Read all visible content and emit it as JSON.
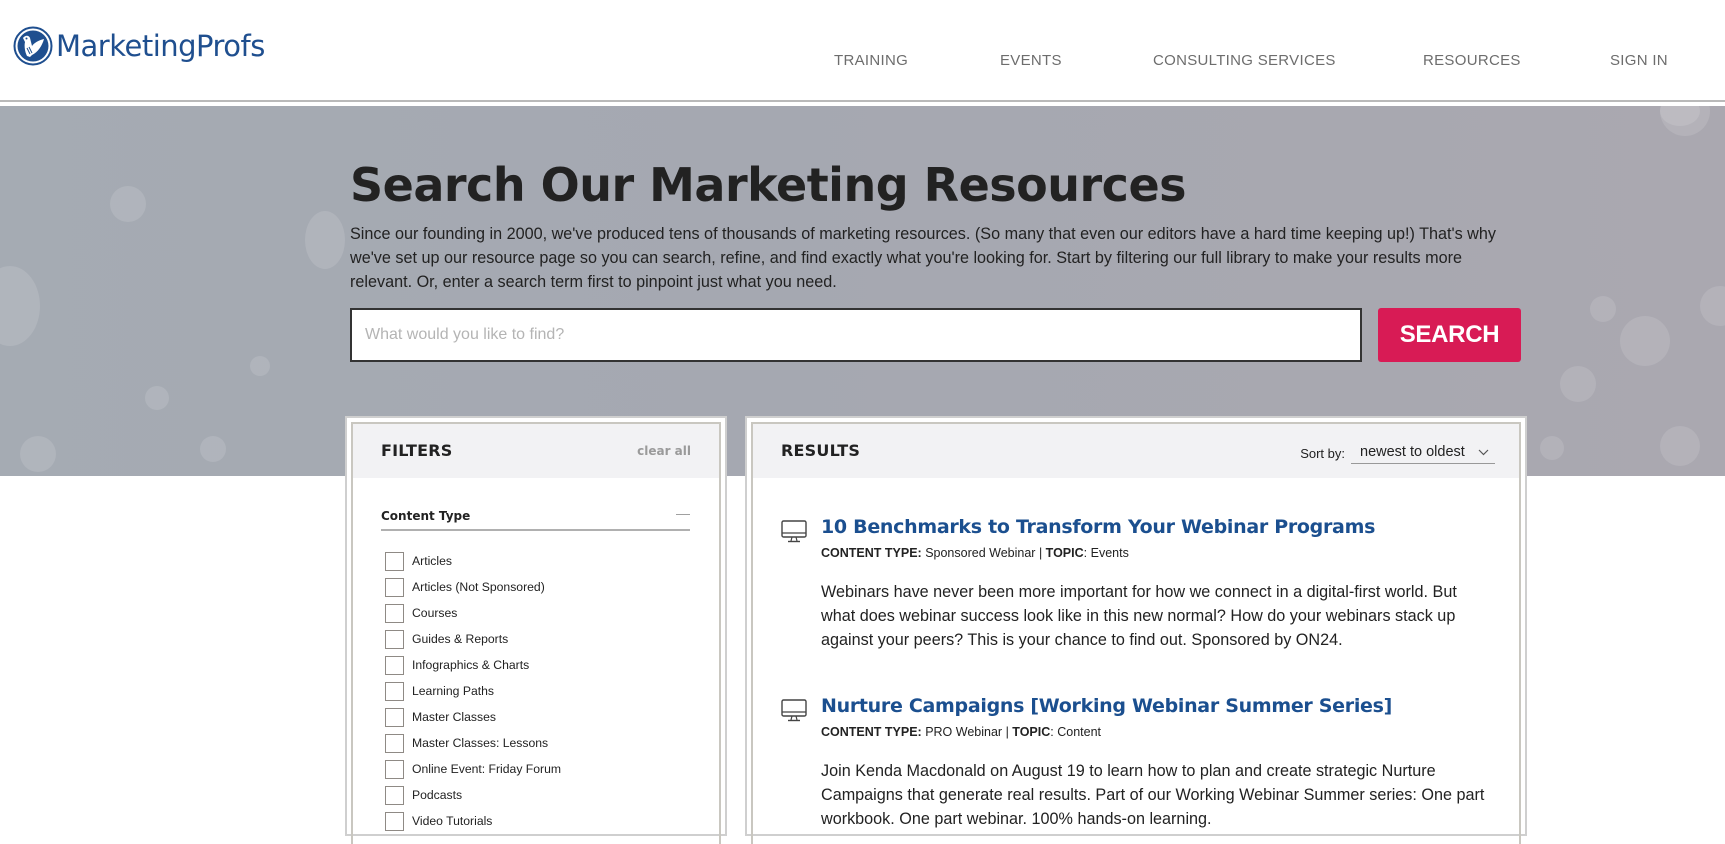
{
  "brand": {
    "name": "MarketingProfs",
    "logo_icon": "bird-circle-logo-icon",
    "brand_color": "#1f4f8f"
  },
  "nav": {
    "items": [
      {
        "label": "TRAINING"
      },
      {
        "label": "EVENTS"
      },
      {
        "label": "CONSULTING SERVICES"
      },
      {
        "label": "RESOURCES"
      },
      {
        "label": "SIGN IN"
      }
    ]
  },
  "hero": {
    "title": "Search Our Marketing Resources",
    "description": "Since our founding in 2000, we've produced tens of thousands of marketing resources. (So many that even our editors have a hard time keeping up!) That's why we've set up our resource page so you can search, refine, and find exactly what you're looking for. Start by filtering our full library to make your results more relevant. Or, enter a search term first to pinpoint just what you need.",
    "search": {
      "placeholder": "What would you like to find?",
      "value": "",
      "button_label": "SEARCH",
      "button_color": "#d81b55"
    }
  },
  "filters": {
    "title": "FILTERS",
    "clear_all": "clear all",
    "content_type": {
      "title": "Content Type",
      "toggle": "—",
      "options": [
        {
          "label": "Articles",
          "checked": false
        },
        {
          "label": "Articles (Not Sponsored)",
          "checked": false
        },
        {
          "label": "Courses",
          "checked": false
        },
        {
          "label": "Guides & Reports",
          "checked": false
        },
        {
          "label": "Infographics & Charts",
          "checked": false
        },
        {
          "label": "Learning Paths",
          "checked": false
        },
        {
          "label": "Master Classes",
          "checked": false
        },
        {
          "label": "Master Classes: Lessons",
          "checked": false
        },
        {
          "label": "Online Event: Friday Forum",
          "checked": false
        },
        {
          "label": "Podcasts",
          "checked": false
        },
        {
          "label": "Video Tutorials",
          "checked": false
        }
      ]
    }
  },
  "results": {
    "title": "RESULTS",
    "sort_label": "Sort by:",
    "sort_value": "newest to oldest",
    "sort_icon": "chevron-down-icon",
    "items": [
      {
        "icon": "monitor-icon",
        "title": "10 Benchmarks to Transform Your Webinar Programs",
        "content_type_label": "CONTENT TYPE:",
        "content_type": "Sponsored Webinar",
        "separator": "|",
        "topic_label": "TOPIC",
        "topic": "Events",
        "description": "Webinars have never been more important for how we connect in a digital-first world. But what does webinar success look like in this new normal? How do your webinars stack up against your peers? This is your chance to find out. Sponsored by ON24."
      },
      {
        "icon": "monitor-icon",
        "title": "Nurture Campaigns [Working Webinar Summer Series]",
        "content_type_label": "CONTENT TYPE:",
        "content_type": "PRO Webinar",
        "separator": "|",
        "topic_label": "TOPIC",
        "topic": "Content",
        "description": "Join Kenda Macdonald on August 19 to learn how to plan and create strategic Nurture Campaigns that generate real results. Part of our Working Webinar Summer series: One part workbook. One part webinar. 100% hands-on learning."
      }
    ]
  }
}
